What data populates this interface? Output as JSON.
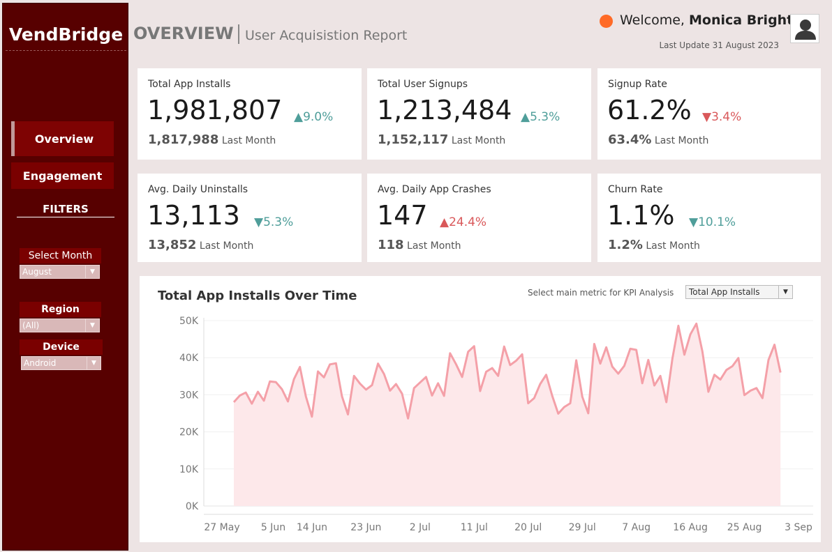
{
  "sidebar": {
    "brand": "VendBridge",
    "nav": [
      {
        "label": "Overview",
        "active": true
      },
      {
        "label": "Engagement",
        "active": false
      }
    ],
    "filters_title": "FILTERS",
    "filters": [
      {
        "label": "Select Month",
        "value": "August"
      },
      {
        "label": "Region",
        "value": "(All)"
      },
      {
        "label": "Device",
        "value": "Android"
      }
    ]
  },
  "header": {
    "title": "OVERVIEW",
    "subtitle": "User Acquisistion Report",
    "welcome_prefix": "Welcome,",
    "user_name": "Monica Bright",
    "last_update": "Last Update 31 August 2023",
    "status_color": "#ff6a26"
  },
  "kpis": [
    {
      "label": "Total App Installs",
      "value": "1,981,807",
      "delta": "▲9.0%",
      "prev": "1,817,988",
      "prev_suffix": "Last Month",
      "tone": "good"
    },
    {
      "label": "Total User Signups",
      "value": "1,213,484",
      "delta": "▲5.3%",
      "prev": "1,152,117",
      "prev_suffix": "Last Month",
      "tone": "good"
    },
    {
      "label": "Signup Rate",
      "value": "61.2%",
      "delta": "▼3.4%",
      "prev": "63.4%",
      "prev_suffix": "Last Month",
      "tone": "bad"
    },
    {
      "label": "Avg. Daily Uninstalls",
      "value": "13,113",
      "delta": "▼5.3%",
      "prev": "13,852",
      "prev_suffix": "Last Month",
      "tone": "good"
    },
    {
      "label": "Avg. Daily App Crashes",
      "value": "147",
      "delta": "▲24.4%",
      "prev": "118",
      "prev_suffix": "Last Month",
      "tone": "bad"
    },
    {
      "label": "Churn Rate",
      "value": "1.1%",
      "delta": "▼10.1%",
      "prev": "1.2%",
      "prev_suffix": "Last Month",
      "tone": "good"
    }
  ],
  "colors": {
    "good": "#4f9e9a",
    "bad": "#d9585a",
    "line": "#f4a0a8",
    "area": "#fde8ea",
    "accent": "#570000"
  },
  "chart": {
    "metric_label": "Select main metric for KPI Analysis",
    "metric_value": "Total App Installs"
  },
  "chart_data": {
    "type": "area",
    "title": "Total App Installs Over Time",
    "xlabel": "",
    "ylabel": "",
    "ylim": [
      0,
      50000
    ],
    "y_ticks": [
      "0K",
      "10K",
      "20K",
      "30K",
      "40K",
      "50K"
    ],
    "x_ticks": [
      "27 May",
      "5 Jun",
      "14 Jun",
      "23 Jun",
      "2 Jul",
      "11 Jul",
      "20 Jul",
      "29 Jul",
      "7 Aug",
      "16 Aug",
      "25 Aug",
      "3 Sep"
    ],
    "x_start": "2023-06-01",
    "grid": true,
    "series": [
      {
        "values": [
          28000,
          29800,
          30600,
          27600,
          30800,
          28400,
          33600,
          33400,
          31500,
          28200,
          34200,
          37500,
          29500,
          24100,
          36300,
          34700,
          38200,
          38500,
          29600,
          24700,
          35100,
          33000,
          31400,
          32600,
          38400,
          35600,
          31100,
          32900,
          30300,
          23600,
          31800,
          33300,
          34800,
          29800,
          33100,
          29700,
          41200,
          38200,
          34800,
          41600,
          43100,
          31000,
          36200,
          37200,
          35100,
          43000,
          38000,
          39200,
          40900,
          27700,
          29100,
          32900,
          35400,
          29700,
          24900,
          26700,
          27700,
          39300,
          29500,
          25000,
          43700,
          38400,
          42800,
          37600,
          35700,
          37800,
          42400,
          42100,
          33100,
          39400,
          32500,
          35100,
          28000,
          39700,
          48600,
          40800,
          46300,
          49200,
          41700,
          30800,
          35400,
          34100,
          36700,
          37700,
          39900,
          29900,
          31100,
          31800,
          29100,
          39400,
          43500,
          36000
        ]
      }
    ]
  }
}
